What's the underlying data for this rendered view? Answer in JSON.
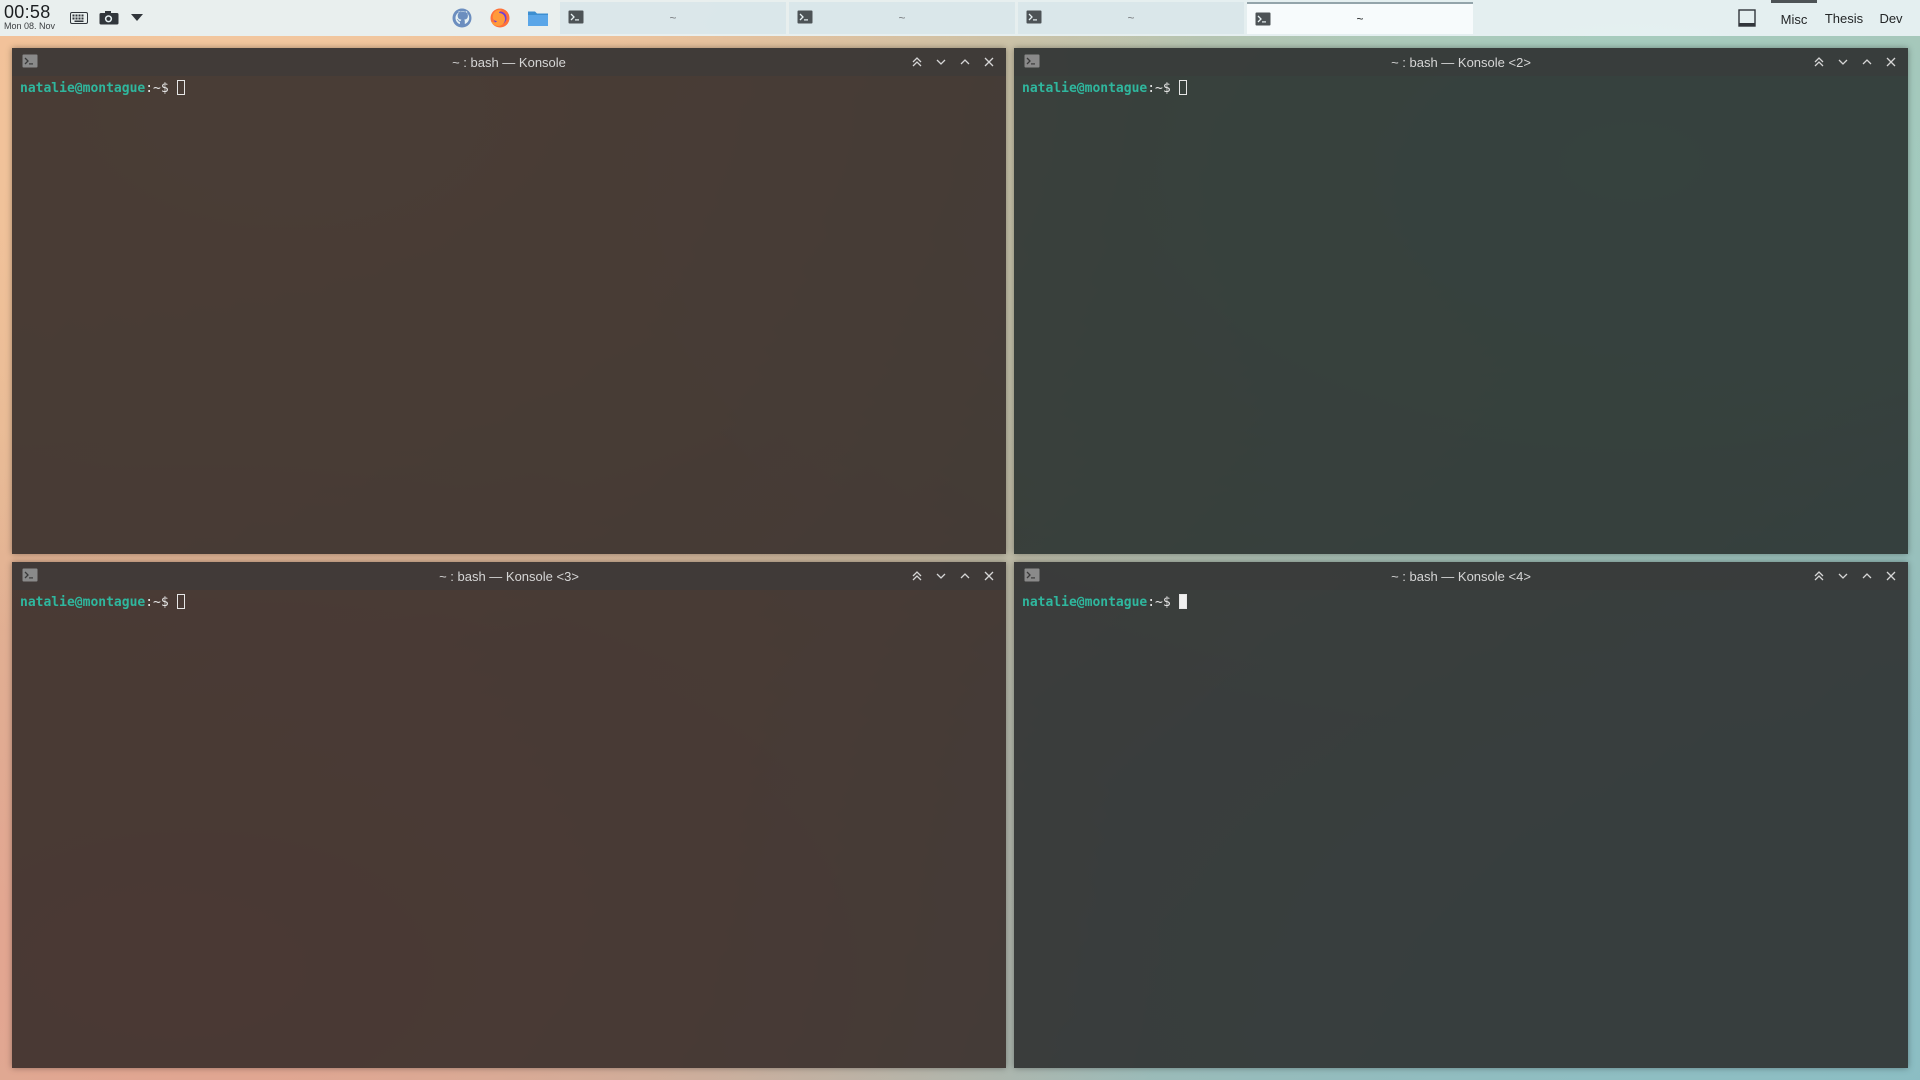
{
  "panel": {
    "clock": {
      "time": "00:58",
      "date": "Mon 08. Nov"
    },
    "tray": [
      {
        "name": "keyboard-icon"
      },
      {
        "name": "camera-icon"
      },
      {
        "name": "chevron-down-icon"
      }
    ],
    "launchers": [
      {
        "name": "github-desktop-icon"
      },
      {
        "name": "firefox-icon"
      },
      {
        "name": "files-icon"
      }
    ],
    "tasks": [
      {
        "label": "~",
        "active": false
      },
      {
        "label": "~",
        "active": false
      },
      {
        "label": "~",
        "active": false
      },
      {
        "label": "~",
        "active": true
      }
    ],
    "desktops": [
      {
        "label": "Misc",
        "current": true
      },
      {
        "label": "Thesis",
        "current": false
      },
      {
        "label": "Dev",
        "current": false
      }
    ]
  },
  "windows": [
    {
      "title": "~ : bash — Konsole",
      "prompt_user": "natalie@montague",
      "prompt_path": ":~$",
      "cursor_filled": false
    },
    {
      "title": "~ : bash — Konsole <2>",
      "prompt_user": "natalie@montague",
      "prompt_path": ":~$",
      "cursor_filled": false
    },
    {
      "title": "~ : bash — Konsole <3>",
      "prompt_user": "natalie@montague",
      "prompt_path": ":~$",
      "cursor_filled": false
    },
    {
      "title": "~ : bash — Konsole <4>",
      "prompt_user": "natalie@montague",
      "prompt_path": ":~$",
      "cursor_filled": true
    }
  ],
  "colors": {
    "prompt_user": "#2fb79e",
    "panel_bg": "#e8f2f4",
    "terminal_text": "#e6e6e6"
  }
}
